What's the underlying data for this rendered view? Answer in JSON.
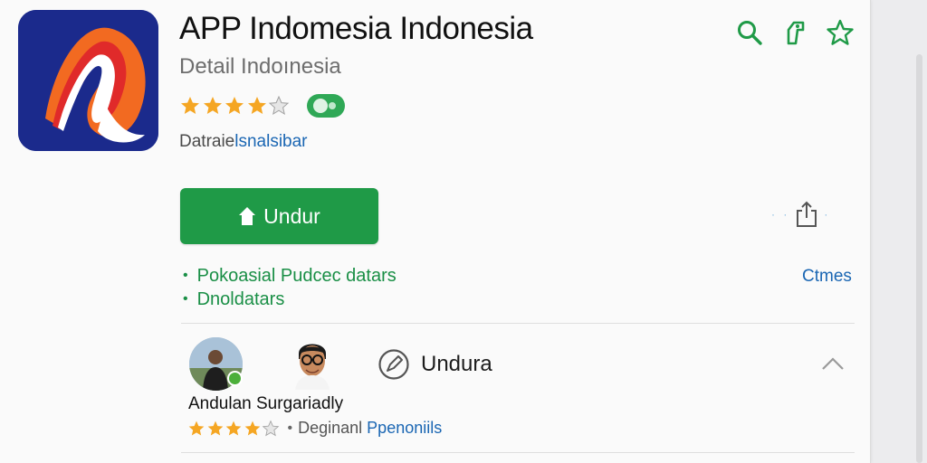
{
  "app": {
    "title": "APP Indomesia Indonesia",
    "subtitle": "Detail Indoınesia",
    "rating": 4,
    "rating_max": 5,
    "meta_a": "Datraie",
    "meta_b": "lsnalsibar"
  },
  "toolbar": {
    "icons": [
      "search-icon",
      "tag-icon",
      "star-outline-icon"
    ]
  },
  "install": {
    "label": "Undur",
    "icon": "house-icon"
  },
  "share": {
    "icon": "share-icon"
  },
  "details": {
    "items": [
      "Pokoasial Pudcec datars",
      "Dnoldatars"
    ],
    "more_label": "Ctmes"
  },
  "review": {
    "action_label": "Undura",
    "reviewer_name": "Andulan Surgariadly",
    "rating": 4,
    "rating_max": 5,
    "meta_a": "Deginanl",
    "meta_b": "Ppenoniils"
  },
  "colors": {
    "accent": "#1f9a47",
    "link": "#1a66b3",
    "star": "#f5a623",
    "icon_bg": "#1b2a8c"
  }
}
